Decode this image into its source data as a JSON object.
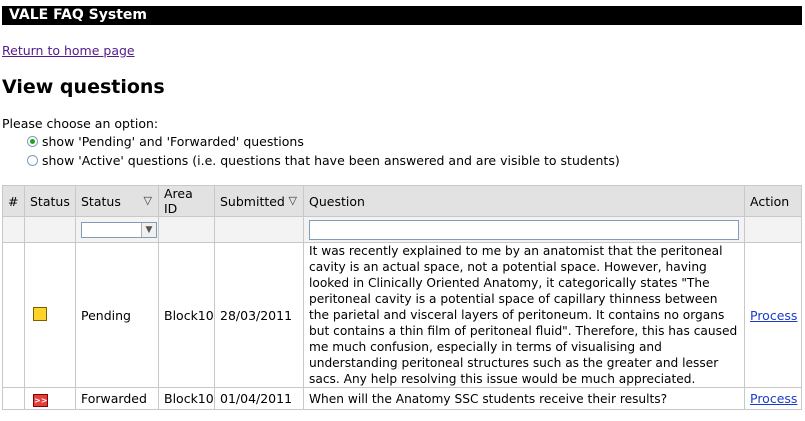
{
  "app": {
    "title": "VALE FAQ System"
  },
  "nav": {
    "home_link": "Return to home page"
  },
  "page": {
    "title": "View questions"
  },
  "options": {
    "prompt": "Please choose an option:",
    "items": [
      {
        "label": "show 'Pending' and 'Forwarded' questions",
        "selected": true
      },
      {
        "label": "show 'Active' questions (i.e. questions that have been answered and are visible to students)",
        "selected": false
      }
    ]
  },
  "table": {
    "headers": [
      "#",
      "Status",
      "Status",
      "Area ID",
      "Submitted",
      "Question",
      "Action"
    ],
    "sort_indicator": "▽",
    "filter": {
      "status_value": "",
      "question_value": ""
    },
    "rows": [
      {
        "status_icon": "pending-square-icon",
        "status": "Pending",
        "area_id": "Block10",
        "submitted": "28/03/2011",
        "question": "It was recently explained to me by an anatomist that the peritoneal cavity is an actual space, not a potential space. However, having looked in Clinically Oriented Anatomy, it categorically states \"The peritoneal cavity is a potential space of capillary thinness between the parietal and visceral layers of peritoneum. It contains no organs but contains a thin film of peritoneal fluid\". Therefore, this has caused me much confusion, especially in terms of visualising and understanding peritoneal structures such as the greater and lesser sacs. Any help resolving this issue would be much appreciated.",
        "action": "Process"
      },
      {
        "status_icon": "forwarded-arrow-icon",
        "status_glyph": ">>",
        "status": "Forwarded",
        "area_id": "Block10",
        "submitted": "01/04/2011",
        "question": "When will the Anatomy SSC students receive their results?",
        "action": "Process"
      }
    ]
  },
  "colors": {
    "titlebar": "#000000",
    "pending": "#ffd42a",
    "forwarded": "#e63c3c",
    "link": "#1a3cc8"
  }
}
